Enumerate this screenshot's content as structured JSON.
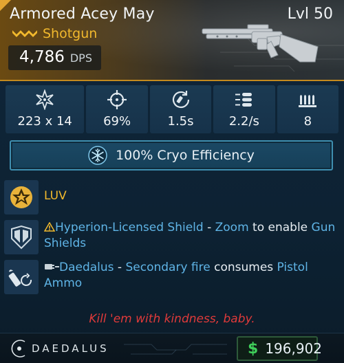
{
  "header": {
    "weapon_name": "Armored Acey May",
    "level": "Lvl 50",
    "weapon_type": "Shotgun",
    "rarity_icon": "rarity-chevrons-icon",
    "dps_value": "4,786",
    "dps_unit": "DPS",
    "accent": "#c48a1e"
  },
  "stats": [
    {
      "icon": "damage-icon",
      "value": "223 x 14"
    },
    {
      "icon": "accuracy-icon",
      "value": "69%"
    },
    {
      "icon": "reload-time-icon",
      "value": "1.5s"
    },
    {
      "icon": "fire-rate-icon",
      "value": "2.2/s"
    },
    {
      "icon": "magazine-size-icon",
      "value": "8"
    }
  ],
  "element": {
    "icon": "cryo-icon",
    "text": "100% Cryo Efficiency",
    "color": "#3f8fb0"
  },
  "perks": [
    {
      "icon": "luv-icon",
      "name": "LUV"
    },
    {
      "icon": "hyperion-shield-icon",
      "warning_icon": "warning-icon",
      "name": "Hyperion-Licensed Shield",
      "sep": " - ",
      "action": "Zoom",
      "middle": " to enable ",
      "result": "Gun Shields"
    },
    {
      "icon": "pistol-ammo-icon",
      "plug_icon": "manufacturer-plug-icon",
      "name": "Daedalus",
      "sep": " - ",
      "action": "Secondary fire",
      "middle": " consumes ",
      "result": "Pistol Ammo"
    }
  ],
  "flavor_text": "Kill 'em with kindness, baby.",
  "footer": {
    "manufacturer": "DAEDALUS",
    "manufacturer_icon": "daedalus-logo-icon",
    "currency_icon": "dollar-icon",
    "currency_sign": "$",
    "price": "196,902",
    "price_color": "#3fcf5a"
  }
}
